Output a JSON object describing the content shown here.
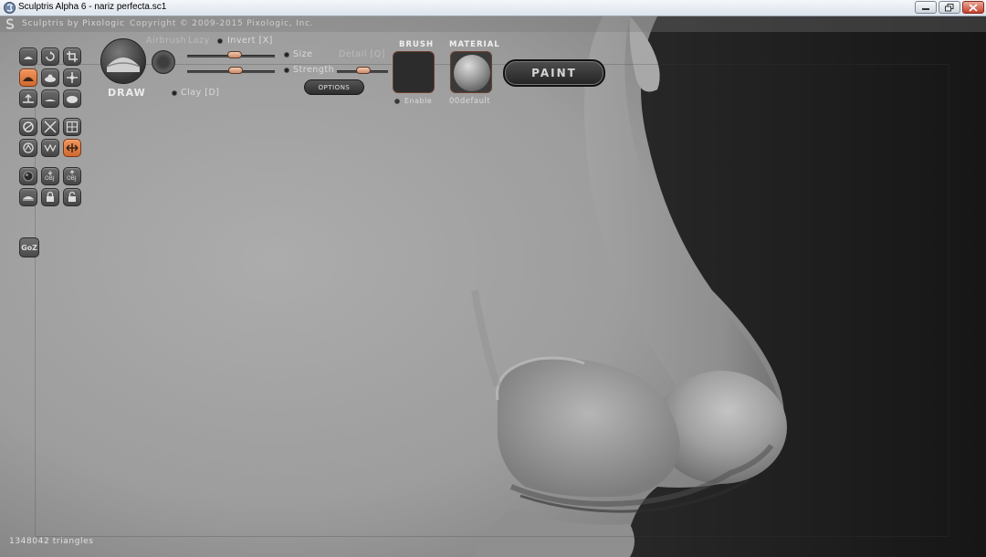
{
  "window": {
    "title": "Sculptris Alpha 6 - nariz perfecta.sc1",
    "controls": [
      "minimize-icon",
      "maximize-icon",
      "close-icon"
    ]
  },
  "header": {
    "app_label": "Sculptris by Pixologic",
    "copyright": "Copyright © 2009-2015 Pixologic, Inc."
  },
  "toolbar": {
    "tools": [
      {
        "name": "tool-draw-mode",
        "icon": "draw-icon"
      },
      {
        "name": "tool-rotate",
        "icon": "rotate-icon"
      },
      {
        "name": "tool-crop",
        "icon": "crop-icon"
      },
      {
        "name": "tool-draw",
        "icon": "draw-brush-icon",
        "active": true
      },
      {
        "name": "tool-inflate",
        "icon": "inflate-icon"
      },
      {
        "name": "tool-move",
        "icon": "move-icon"
      },
      {
        "name": "tool-pinch",
        "icon": "pinch-icon"
      },
      {
        "name": "tool-flatten",
        "icon": "flatten-icon"
      },
      {
        "name": "tool-smooth",
        "icon": "smooth-icon"
      },
      {
        "name": "tool-rotate-view",
        "icon": "rotate-view-icon"
      },
      {
        "name": "tool-scale",
        "icon": "scale-icon"
      },
      {
        "name": "tool-grid",
        "icon": "grid-icon"
      },
      {
        "name": "tool-mask",
        "icon": "mask-icon"
      },
      {
        "name": "tool-reduce",
        "icon": "reduce-icon"
      },
      {
        "name": "tool-symmetry",
        "icon": "symmetry-icon",
        "active": true
      },
      {
        "name": "tool-new-sphere",
        "icon": "sphere-icon"
      },
      {
        "name": "tool-import",
        "icon": "import-obj-icon"
      },
      {
        "name": "tool-export",
        "icon": "export-obj-icon"
      },
      {
        "name": "tool-plane",
        "icon": "plane-icon"
      },
      {
        "name": "tool-lock",
        "icon": "lock-icon"
      },
      {
        "name": "tool-unlock",
        "icon": "unlock-icon"
      }
    ],
    "goz_label": "GoZ"
  },
  "brush": {
    "mode_label": "DRAW",
    "airbrush_label": "Airbrush",
    "lazy_label": "Lazy",
    "invert_label": "Invert [X]",
    "clay_label": "Clay [D]",
    "size_label": "Size",
    "strength_label": "Strength",
    "detail_label": "Detail [Q]",
    "options_label": "OPTIONS"
  },
  "brush_slot": {
    "title": "BRUSH",
    "enable_label": "Enable"
  },
  "material": {
    "title": "MATERIAL",
    "name": "00default"
  },
  "paint": {
    "label": "PAINT"
  },
  "status": {
    "triangles": "1348042 triangles"
  },
  "colors": {
    "accent": "#e07c40",
    "viewport_bg": "#9a9a9a",
    "dark_bg": "#1c1c1c"
  }
}
